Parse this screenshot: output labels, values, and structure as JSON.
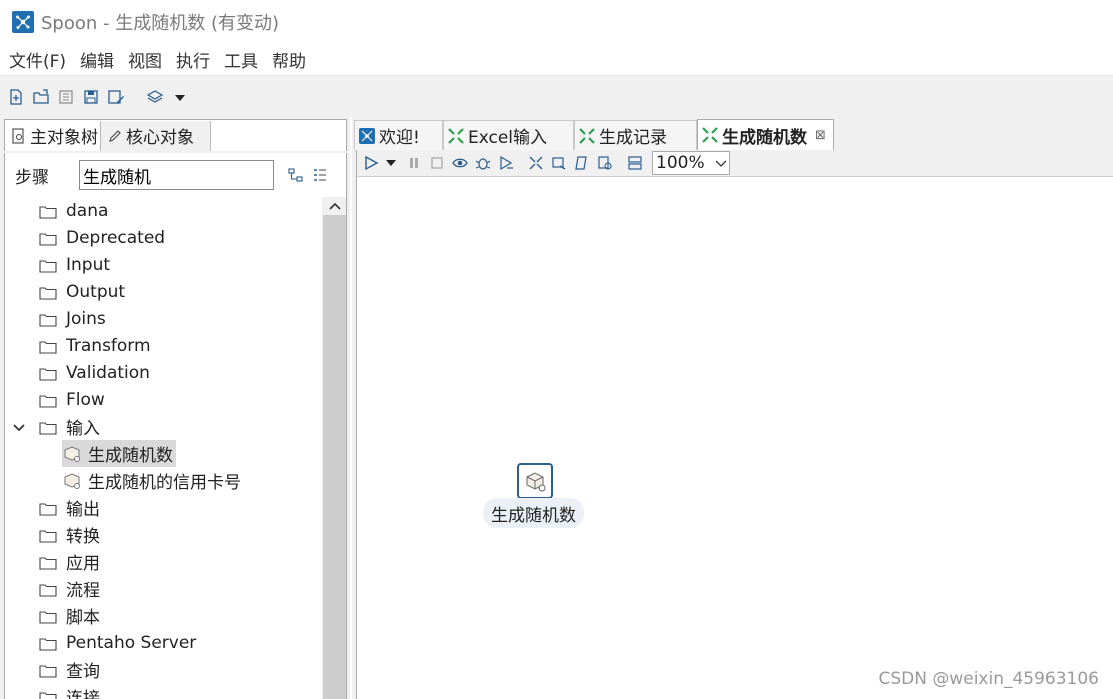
{
  "window": {
    "title": "Spoon - 生成随机数 (有变动)"
  },
  "menu": {
    "items": [
      "文件(F)",
      "编辑",
      "视图",
      "执行",
      "工具",
      "帮助"
    ]
  },
  "left_panel": {
    "tabs": [
      "主对象树",
      "核心对象"
    ],
    "step_label": "步骤",
    "search_value": "生成随机",
    "tree": [
      {
        "label": "dana",
        "type": "folder"
      },
      {
        "label": "Deprecated",
        "type": "folder"
      },
      {
        "label": "Input",
        "type": "folder"
      },
      {
        "label": "Output",
        "type": "folder"
      },
      {
        "label": "Joins",
        "type": "folder"
      },
      {
        "label": "Transform",
        "type": "folder"
      },
      {
        "label": "Validation",
        "type": "folder"
      },
      {
        "label": "Flow",
        "type": "folder"
      },
      {
        "label": "输入",
        "type": "folder",
        "expanded": true
      },
      {
        "label": "生成随机数",
        "type": "step",
        "selected": true
      },
      {
        "label": "生成随机的信用卡号",
        "type": "step"
      },
      {
        "label": "输出",
        "type": "folder"
      },
      {
        "label": "转换",
        "type": "folder"
      },
      {
        "label": "应用",
        "type": "folder"
      },
      {
        "label": "流程",
        "type": "folder"
      },
      {
        "label": "脚本",
        "type": "folder"
      },
      {
        "label": "Pentaho Server",
        "type": "folder"
      },
      {
        "label": "查询",
        "type": "folder"
      },
      {
        "label": "连接",
        "type": "folder"
      }
    ]
  },
  "editor": {
    "tabs": [
      {
        "label": "欢迎!",
        "icon": "spoon-icon"
      },
      {
        "label": "Excel输入",
        "icon": "transformation-icon"
      },
      {
        "label": "生成记录",
        "icon": "transformation-icon"
      },
      {
        "label": "生成随机数",
        "icon": "transformation-icon",
        "active": true
      }
    ],
    "zoom": "100%",
    "canvas_step_label": "生成随机数"
  },
  "watermark": "CSDN @weixin_45963106",
  "colors": {
    "accent": "#1f6fb2",
    "transform_icon": "#2e9e4f",
    "selection": "#d9d9d9"
  }
}
